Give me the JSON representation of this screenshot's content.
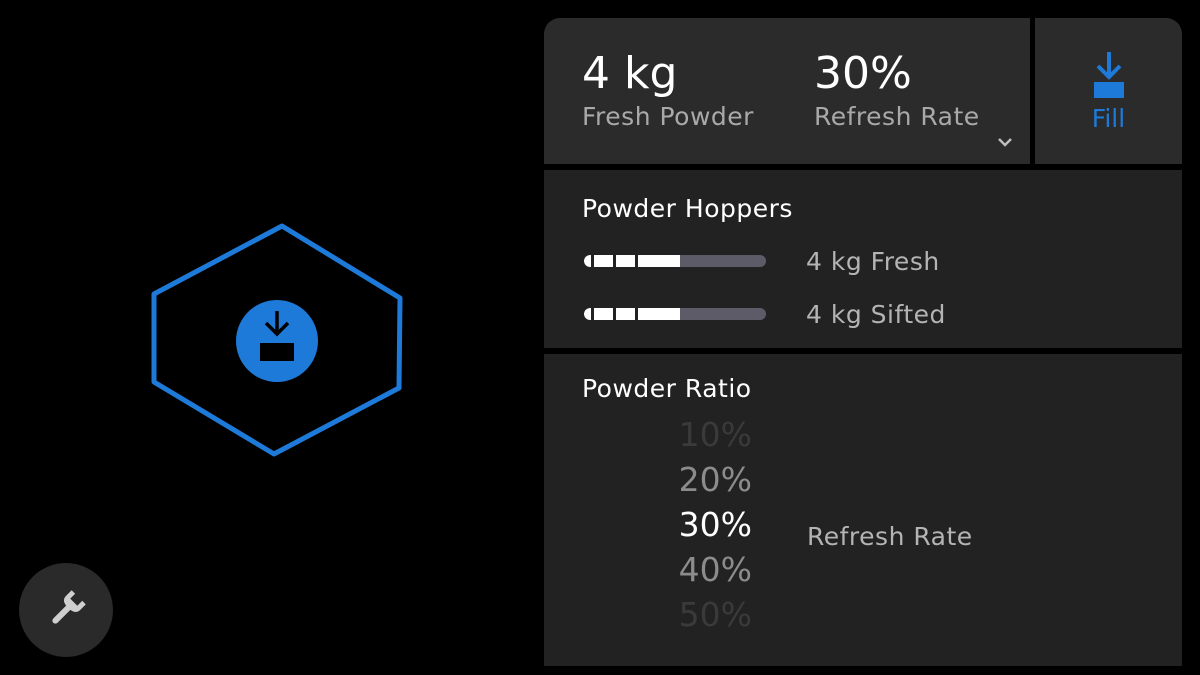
{
  "summary": {
    "fresh_powder_value": "4 kg",
    "fresh_powder_label": "Fresh Powder",
    "refresh_rate_value": "30%",
    "refresh_rate_label": "Refresh Rate"
  },
  "fill_button": {
    "label": "Fill",
    "icon": "download-tray-icon"
  },
  "hoppers": {
    "title": "Powder Hoppers",
    "items": [
      {
        "label": "4 kg Fresh",
        "level": 0.53
      },
      {
        "label": "4 kg Sifted",
        "level": 0.53
      }
    ]
  },
  "ratio": {
    "title": "Powder Ratio",
    "options": [
      "10%",
      "20%",
      "30%",
      "40%",
      "50%"
    ],
    "selected": "30%",
    "label": "Refresh Rate"
  },
  "colors": {
    "accent": "#1e7ad8",
    "panel": "#2b2b2b",
    "card": "#222222",
    "bar_track": "#5e5b69"
  },
  "icons": {
    "hex": "hexagon-outline-icon",
    "center": "download-tray-icon",
    "tools": "wrench-icon",
    "dropdown": "chevron-down-icon"
  }
}
